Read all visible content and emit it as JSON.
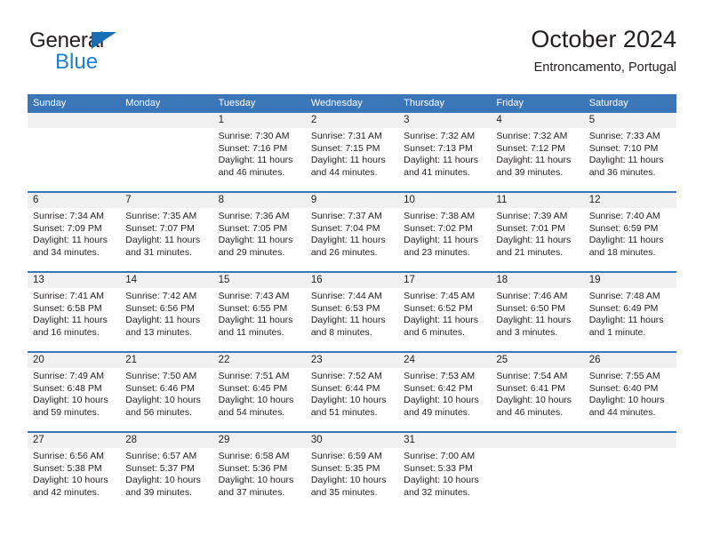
{
  "brand": {
    "name_part1": "General",
    "name_part2": "Blue",
    "triangle_color": "#1a6cb5",
    "blue_color": "#1b7fd4"
  },
  "header": {
    "title": "October 2024",
    "subtitle": "Entroncamento, Portugal"
  },
  "colors": {
    "header_blue": "#3a76b8",
    "number_band": "#f0f0f0",
    "text": "#231f20"
  },
  "weekdays": [
    "Sunday",
    "Monday",
    "Tuesday",
    "Wednesday",
    "Thursday",
    "Friday",
    "Saturday"
  ],
  "weeks": [
    [
      {
        "day": "",
        "sunrise": "",
        "sunset": "",
        "daylight": ""
      },
      {
        "day": "",
        "sunrise": "",
        "sunset": "",
        "daylight": ""
      },
      {
        "day": "1",
        "sunrise": "Sunrise: 7:30 AM",
        "sunset": "Sunset: 7:16 PM",
        "daylight": "Daylight: 11 hours and 46 minutes."
      },
      {
        "day": "2",
        "sunrise": "Sunrise: 7:31 AM",
        "sunset": "Sunset: 7:15 PM",
        "daylight": "Daylight: 11 hours and 44 minutes."
      },
      {
        "day": "3",
        "sunrise": "Sunrise: 7:32 AM",
        "sunset": "Sunset: 7:13 PM",
        "daylight": "Daylight: 11 hours and 41 minutes."
      },
      {
        "day": "4",
        "sunrise": "Sunrise: 7:32 AM",
        "sunset": "Sunset: 7:12 PM",
        "daylight": "Daylight: 11 hours and 39 minutes."
      },
      {
        "day": "5",
        "sunrise": "Sunrise: 7:33 AM",
        "sunset": "Sunset: 7:10 PM",
        "daylight": "Daylight: 11 hours and 36 minutes."
      }
    ],
    [
      {
        "day": "6",
        "sunrise": "Sunrise: 7:34 AM",
        "sunset": "Sunset: 7:09 PM",
        "daylight": "Daylight: 11 hours and 34 minutes."
      },
      {
        "day": "7",
        "sunrise": "Sunrise: 7:35 AM",
        "sunset": "Sunset: 7:07 PM",
        "daylight": "Daylight: 11 hours and 31 minutes."
      },
      {
        "day": "8",
        "sunrise": "Sunrise: 7:36 AM",
        "sunset": "Sunset: 7:05 PM",
        "daylight": "Daylight: 11 hours and 29 minutes."
      },
      {
        "day": "9",
        "sunrise": "Sunrise: 7:37 AM",
        "sunset": "Sunset: 7:04 PM",
        "daylight": "Daylight: 11 hours and 26 minutes."
      },
      {
        "day": "10",
        "sunrise": "Sunrise: 7:38 AM",
        "sunset": "Sunset: 7:02 PM",
        "daylight": "Daylight: 11 hours and 23 minutes."
      },
      {
        "day": "11",
        "sunrise": "Sunrise: 7:39 AM",
        "sunset": "Sunset: 7:01 PM",
        "daylight": "Daylight: 11 hours and 21 minutes."
      },
      {
        "day": "12",
        "sunrise": "Sunrise: 7:40 AM",
        "sunset": "Sunset: 6:59 PM",
        "daylight": "Daylight: 11 hours and 18 minutes."
      }
    ],
    [
      {
        "day": "13",
        "sunrise": "Sunrise: 7:41 AM",
        "sunset": "Sunset: 6:58 PM",
        "daylight": "Daylight: 11 hours and 16 minutes."
      },
      {
        "day": "14",
        "sunrise": "Sunrise: 7:42 AM",
        "sunset": "Sunset: 6:56 PM",
        "daylight": "Daylight: 11 hours and 13 minutes."
      },
      {
        "day": "15",
        "sunrise": "Sunrise: 7:43 AM",
        "sunset": "Sunset: 6:55 PM",
        "daylight": "Daylight: 11 hours and 11 minutes."
      },
      {
        "day": "16",
        "sunrise": "Sunrise: 7:44 AM",
        "sunset": "Sunset: 6:53 PM",
        "daylight": "Daylight: 11 hours and 8 minutes."
      },
      {
        "day": "17",
        "sunrise": "Sunrise: 7:45 AM",
        "sunset": "Sunset: 6:52 PM",
        "daylight": "Daylight: 11 hours and 6 minutes."
      },
      {
        "day": "18",
        "sunrise": "Sunrise: 7:46 AM",
        "sunset": "Sunset: 6:50 PM",
        "daylight": "Daylight: 11 hours and 3 minutes."
      },
      {
        "day": "19",
        "sunrise": "Sunrise: 7:48 AM",
        "sunset": "Sunset: 6:49 PM",
        "daylight": "Daylight: 11 hours and 1 minute."
      }
    ],
    [
      {
        "day": "20",
        "sunrise": "Sunrise: 7:49 AM",
        "sunset": "Sunset: 6:48 PM",
        "daylight": "Daylight: 10 hours and 59 minutes."
      },
      {
        "day": "21",
        "sunrise": "Sunrise: 7:50 AM",
        "sunset": "Sunset: 6:46 PM",
        "daylight": "Daylight: 10 hours and 56 minutes."
      },
      {
        "day": "22",
        "sunrise": "Sunrise: 7:51 AM",
        "sunset": "Sunset: 6:45 PM",
        "daylight": "Daylight: 10 hours and 54 minutes."
      },
      {
        "day": "23",
        "sunrise": "Sunrise: 7:52 AM",
        "sunset": "Sunset: 6:44 PM",
        "daylight": "Daylight: 10 hours and 51 minutes."
      },
      {
        "day": "24",
        "sunrise": "Sunrise: 7:53 AM",
        "sunset": "Sunset: 6:42 PM",
        "daylight": "Daylight: 10 hours and 49 minutes."
      },
      {
        "day": "25",
        "sunrise": "Sunrise: 7:54 AM",
        "sunset": "Sunset: 6:41 PM",
        "daylight": "Daylight: 10 hours and 46 minutes."
      },
      {
        "day": "26",
        "sunrise": "Sunrise: 7:55 AM",
        "sunset": "Sunset: 6:40 PM",
        "daylight": "Daylight: 10 hours and 44 minutes."
      }
    ],
    [
      {
        "day": "27",
        "sunrise": "Sunrise: 6:56 AM",
        "sunset": "Sunset: 5:38 PM",
        "daylight": "Daylight: 10 hours and 42 minutes."
      },
      {
        "day": "28",
        "sunrise": "Sunrise: 6:57 AM",
        "sunset": "Sunset: 5:37 PM",
        "daylight": "Daylight: 10 hours and 39 minutes."
      },
      {
        "day": "29",
        "sunrise": "Sunrise: 6:58 AM",
        "sunset": "Sunset: 5:36 PM",
        "daylight": "Daylight: 10 hours and 37 minutes."
      },
      {
        "day": "30",
        "sunrise": "Sunrise: 6:59 AM",
        "sunset": "Sunset: 5:35 PM",
        "daylight": "Daylight: 10 hours and 35 minutes."
      },
      {
        "day": "31",
        "sunrise": "Sunrise: 7:00 AM",
        "sunset": "Sunset: 5:33 PM",
        "daylight": "Daylight: 10 hours and 32 minutes."
      },
      {
        "day": "",
        "sunrise": "",
        "sunset": "",
        "daylight": ""
      },
      {
        "day": "",
        "sunrise": "",
        "sunset": "",
        "daylight": ""
      }
    ]
  ]
}
